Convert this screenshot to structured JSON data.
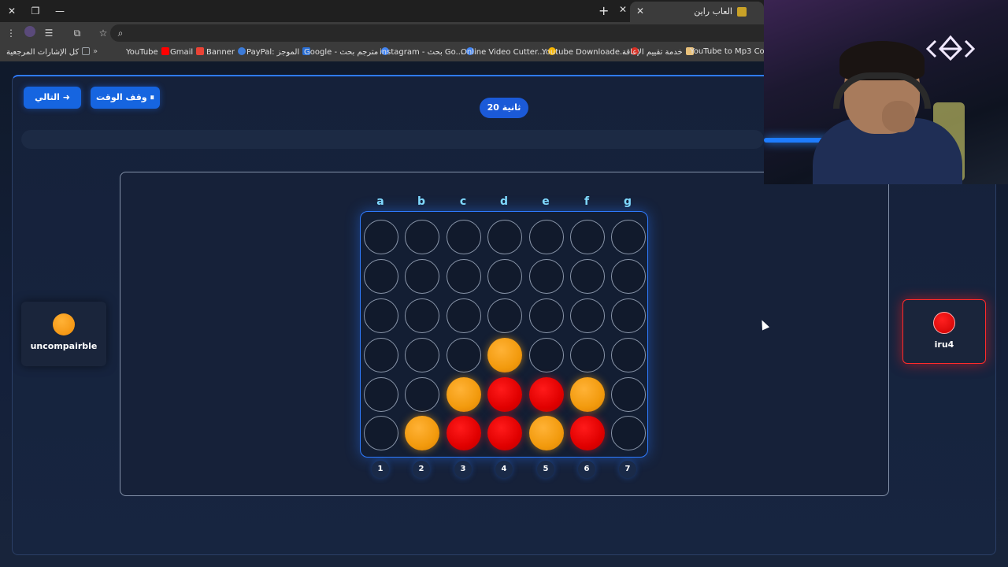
{
  "browser": {
    "tab_title": "العاب راين",
    "new_tab_icon": "plus-icon",
    "bookmarks": [
      {
        "label": "كل الإشارات المرجعية",
        "color": "#9aa0a6"
      },
      {
        "label": "YouTube",
        "color": "#ff0000"
      },
      {
        "label": "Gmail",
        "color": "#ea4335"
      },
      {
        "label": "Banner",
        "color": "#3c7bd8"
      },
      {
        "label": "PayPal: الموجز",
        "color": "#2a6fd6"
      },
      {
        "label": "Google - مترجم بحث",
        "color": "#4285f4"
      },
      {
        "label": "instagram - بحث Go...",
        "color": "#4285f4"
      },
      {
        "label": "Online Video Cutter...",
        "color": "#f6b400"
      },
      {
        "label": "Youtube Downloade...",
        "color": "#d93025"
      },
      {
        "label": "خدمة تقييم الإعاقة",
        "color": "#e8c07a"
      },
      {
        "label": "YouTube to Mp3 Co...",
        "color": "#2b6fd8"
      }
    ]
  },
  "controls": {
    "next_label": "التالي ➜",
    "pause_label": "وقف الوقت ⏸",
    "timer_label": "20 ثانية"
  },
  "board": {
    "columns": [
      "a",
      "b",
      "c",
      "d",
      "e",
      "f",
      "g"
    ],
    "column_numbers": [
      "1",
      "2",
      "3",
      "4",
      "5",
      "6",
      "7"
    ],
    "rows": [
      [
        "empty",
        "empty",
        "empty",
        "empty",
        "empty",
        "empty",
        "empty"
      ],
      [
        "empty",
        "empty",
        "empty",
        "empty",
        "empty",
        "empty",
        "empty"
      ],
      [
        "empty",
        "empty",
        "empty",
        "empty",
        "empty",
        "empty",
        "empty"
      ],
      [
        "empty",
        "empty",
        "empty",
        "yellow",
        "empty",
        "empty",
        "empty"
      ],
      [
        "empty",
        "empty",
        "yellow",
        "red",
        "red",
        "yellow",
        "empty"
      ],
      [
        "empty",
        "yellow",
        "red",
        "red",
        "yellow",
        "red",
        "empty"
      ]
    ]
  },
  "players": {
    "left": {
      "name": "uncompairble",
      "disc": "yellow"
    },
    "right": {
      "name": "iru4",
      "disc": "red",
      "active": true
    }
  },
  "colors": {
    "accent": "#2f7bff",
    "yellow": "#f29a0d",
    "red": "#e00000"
  }
}
